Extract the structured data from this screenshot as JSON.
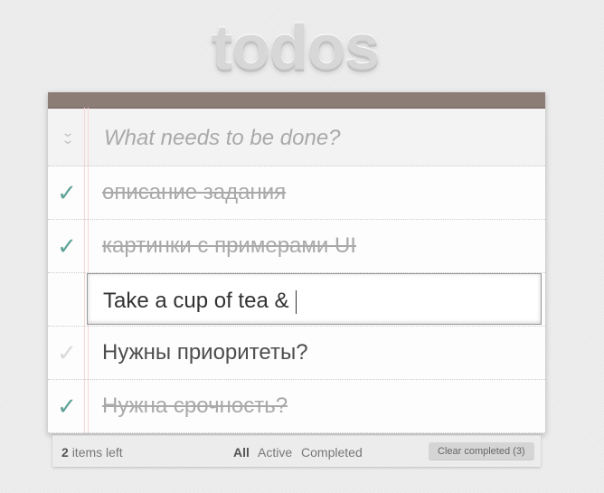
{
  "app": {
    "title": "todos"
  },
  "new_todo": {
    "placeholder": "What needs to be done?",
    "toggle_icon": "double-chevron-down-icon"
  },
  "todos": [
    {
      "label": "описание задания",
      "completed": true
    },
    {
      "label": "картинки с примерами UI",
      "completed": true
    },
    {
      "label": "Take a cup of tea & ",
      "editing": true
    },
    {
      "label": "Нужны приоритеты?",
      "completed": false
    },
    {
      "label": "Нужна срочность?",
      "completed": true
    }
  ],
  "footer": {
    "count_number": "2",
    "count_text": "items left",
    "filters": [
      "All",
      "Active",
      "Completed"
    ],
    "selected_filter": "All",
    "clear_label": "Clear completed (3)"
  },
  "colors": {
    "accent_check": "#5fa297",
    "topbar": "#8d7d77"
  }
}
